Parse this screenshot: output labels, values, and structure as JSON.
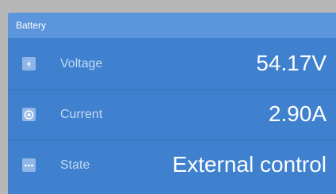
{
  "panel": {
    "title": "Battery",
    "colors": {
      "header_bg": "#5b95dc",
      "panel_bg": "#3f81cf",
      "label": "#c7daf3",
      "value": "#ffffff"
    }
  },
  "rows": [
    {
      "label": "Voltage",
      "value": "54.17V",
      "icon": "battery-icon"
    },
    {
      "label": "Current",
      "value": "2.90A",
      "icon": "current-gauge-icon"
    },
    {
      "label": "State",
      "value": "External control",
      "icon": "more-dots-icon"
    }
  ]
}
